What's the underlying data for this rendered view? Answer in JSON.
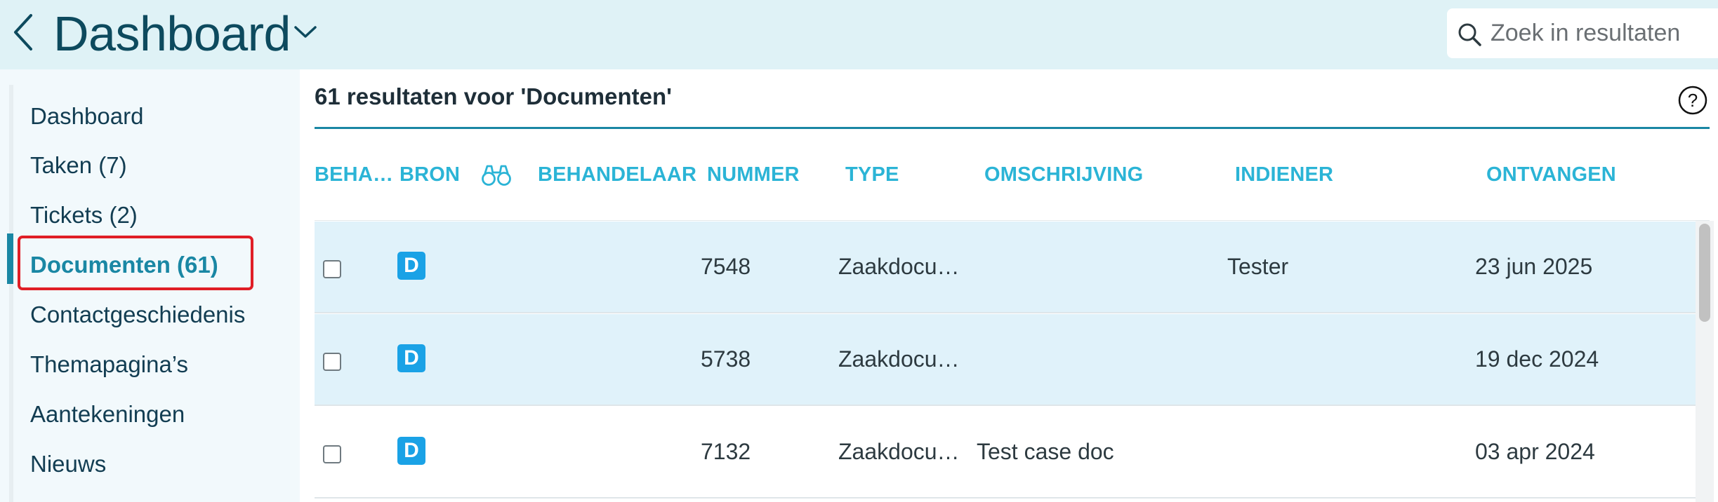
{
  "header": {
    "title": "Dashboard",
    "search_placeholder": "Zoek in resultaten"
  },
  "sidebar": {
    "items": [
      {
        "label": "Dashboard",
        "active": false
      },
      {
        "label": "Taken (7)",
        "active": false
      },
      {
        "label": "Tickets (2)",
        "active": false
      },
      {
        "label": "Documenten (61)",
        "active": true
      },
      {
        "label": "Contactgeschiedenis",
        "active": false
      },
      {
        "label": "Themapagina’s",
        "active": false
      },
      {
        "label": "Aantekeningen",
        "active": false
      },
      {
        "label": "Nieuws",
        "active": false
      }
    ]
  },
  "main": {
    "results_title": "61 resultaten voor 'Documenten'",
    "columns": {
      "behandelaar_short": "BEHA…",
      "bron": "BRON",
      "behandelaar": "BEHANDELAAR",
      "nummer": "NUMMER",
      "type": "TYPE",
      "omschrijving": "OMSCHRIJVING",
      "indiener": "INDIENER",
      "ontvangen": "ONTVANGEN"
    },
    "rows": [
      {
        "source": "D",
        "number": "7548",
        "type": "Zaakdocu…",
        "description": "",
        "submitter": "Tester",
        "received": "23 jun 2025",
        "checked": false,
        "highlighted": true
      },
      {
        "source": "D",
        "number": "5738",
        "type": "Zaakdocu…",
        "description": "",
        "submitter": "",
        "received": "19 dec 2024",
        "checked": false,
        "highlighted": true
      },
      {
        "source": "D",
        "number": "7132",
        "type": "Zaakdocu…",
        "description": "Test case doc",
        "submitter": "",
        "received": "03 apr 2024",
        "checked": false,
        "highlighted": false
      }
    ]
  },
  "icons": {
    "back": "chevron-left-icon",
    "title_dropdown": "chevron-down-icon",
    "search": "search-icon",
    "help": "help-icon",
    "preview": "binoculars-icon"
  },
  "colors": {
    "header_bg": "#dff2f6",
    "sidebar_bg": "#f2f9fc",
    "accent": "#1a87a4",
    "column_header": "#2bb4d6",
    "badge": "#1aa2e6",
    "highlight_border": "#e01e26",
    "row_highlight": "#e0f2fa"
  }
}
